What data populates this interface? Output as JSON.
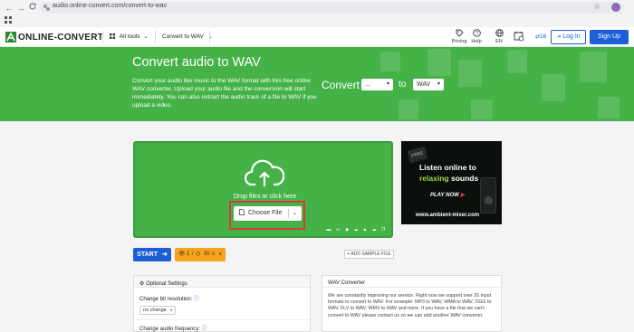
{
  "browser": {
    "url": "audio.online-convert.com/convert-to-wav",
    "back_glyph": "←",
    "forward_glyph": "→",
    "reload_glyph": "C",
    "star_glyph": "☆",
    "apps_glyph": "▦"
  },
  "header": {
    "logo_mark": "🎞",
    "logo_text": "ONLINE-CONVERT",
    "all_tools": "All tools",
    "convert_to": "Convert to WAV",
    "pricing": "Pricing",
    "help": "Help",
    "lang": "EN",
    "credits": "16",
    "login": "Log In",
    "signup": "Sign Up"
  },
  "hero": {
    "title": "Convert audio to WAV",
    "description": "Convert your audio like music to the WAV format with this free online WAV converter. Upload your audio file and the conversion will start immediately. You can also extract the audio track of a file to WAV if you upload a video.",
    "convert_label": "Convert",
    "from_value": "...",
    "to_label": "to",
    "to_value": "WAV"
  },
  "upload": {
    "drop_text": "Drop files or click here",
    "choose_file": "Choose File"
  },
  "ad": {
    "free_badge": "FREE",
    "line1": "Listen online to",
    "line2_green": "relaxing",
    "line2_white": "sounds",
    "play": "PLAY NOW",
    "url": "www.ambient-mixer.com"
  },
  "actions": {
    "start": "START",
    "limit_count": "1",
    "limit_sep": "/",
    "limit_time": "30",
    "limit_unit": "s",
    "add_sample": "+ ADD SAMPLE FILE"
  },
  "settings": {
    "title": "Optional Settings",
    "bit_res_label": "Change bit resolution:",
    "bit_res_value": "no change",
    "freq_label": "Change audio frequency:"
  },
  "wav_converter": {
    "title": "WAV Converter",
    "text": "We are constantly improving our service. Right now we support over 20 input formats to convert to WAV. For example: MP3 to WAV, WMA to WAV, OGG to WAV, FLV to WAV, WMV to WAV and more. If you have a file that we can't convert to WAV please contact us so we can add another WAV converter."
  },
  "colors": {
    "green": "#45b248",
    "blue": "#1c5fd6",
    "orange": "#f7a21b",
    "highlight_red": "#d93b3b"
  }
}
